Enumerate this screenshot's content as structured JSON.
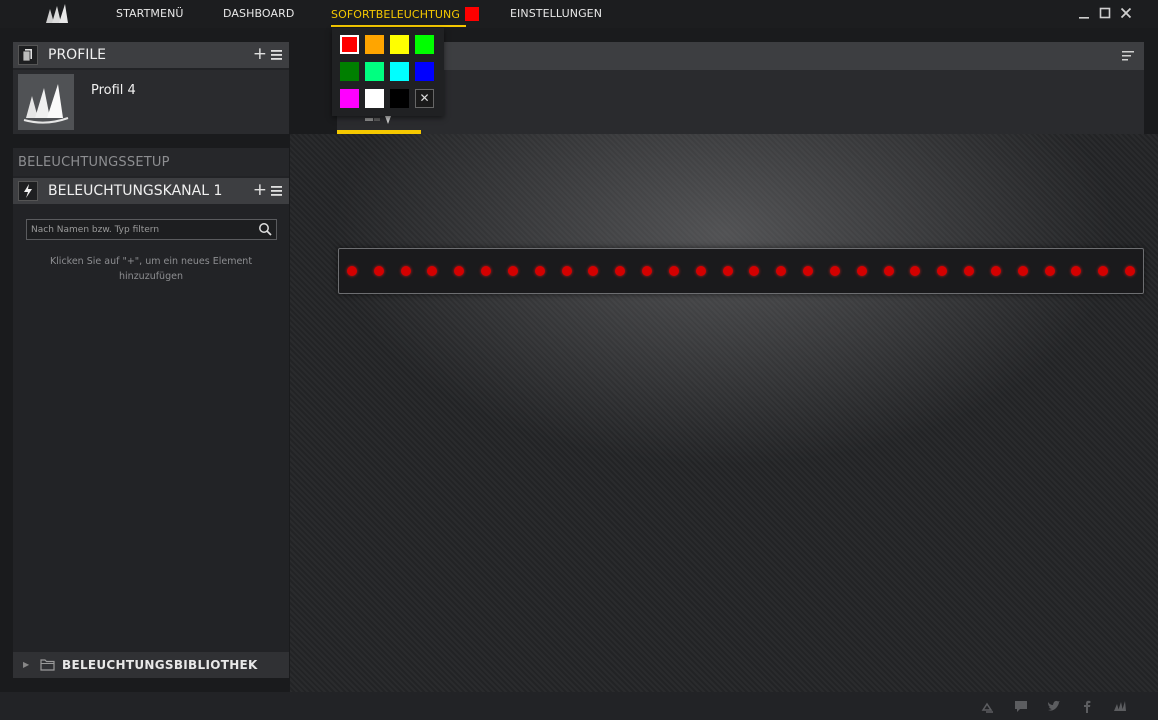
{
  "nav": {
    "items": [
      "STARTMENÜ",
      "DASHBOARD",
      "SOFORTBELEUCHTUNG",
      "EINSTELLUNGEN"
    ],
    "active_index": 2,
    "active_color": "#ff0000"
  },
  "sidebar": {
    "profiles": {
      "title": "PROFILE",
      "items": [
        {
          "name": "Profil 4"
        }
      ]
    },
    "setup_title": "BELEUCHTUNGSSETUP",
    "channel": {
      "title": "BELEUCHTUNGSKANAL 1",
      "filter_placeholder": "Nach Namen bzw. Typ filtern",
      "hint": "Klicken Sie auf \"+\", um ein neues Element hinzuzufügen"
    },
    "library_title": "BELEUCHTUNGSBIBLIOTHEK"
  },
  "color_picker": {
    "selected": "#ff0000",
    "swatches": [
      "#ff0000",
      "#ffa500",
      "#ffff00",
      "#00ff00",
      "#007f00",
      "#00ff80",
      "#00ffff",
      "#0000ff",
      "#ff00ff",
      "#ffffff",
      "#000000"
    ],
    "clear_label": "✕"
  },
  "led_strip": {
    "count": 30,
    "color": "#d40000"
  },
  "colors": {
    "accent": "#f5c800"
  },
  "footer_icons": [
    "link-icon",
    "chat-icon",
    "twitter-icon",
    "facebook-icon",
    "corsair-icon"
  ]
}
